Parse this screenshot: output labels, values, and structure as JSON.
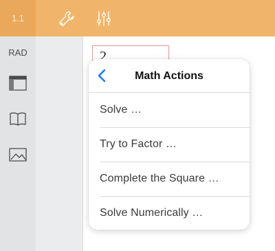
{
  "toolbar": {
    "page_indicator": "1.1",
    "icons": [
      "wrench-icon",
      "sliders-icon"
    ]
  },
  "sidebar": {
    "angle_mode": "RAD",
    "icons": [
      "layout-panel-icon",
      "book-icon",
      "image-icon"
    ]
  },
  "document": {
    "expression_visible": "2"
  },
  "popover": {
    "title": "Math Actions",
    "back_icon": "chevron-left-icon",
    "items": [
      {
        "label": "Solve …"
      },
      {
        "label": "Try to Factor …"
      },
      {
        "label": "Complete the Square …"
      },
      {
        "label": "Solve Numerically …"
      }
    ]
  },
  "colors": {
    "toolbar": "#f0b56a",
    "page_tab": "#eaa95a",
    "accent_blue": "#0a7aff",
    "rail": "#e2e3e4"
  }
}
